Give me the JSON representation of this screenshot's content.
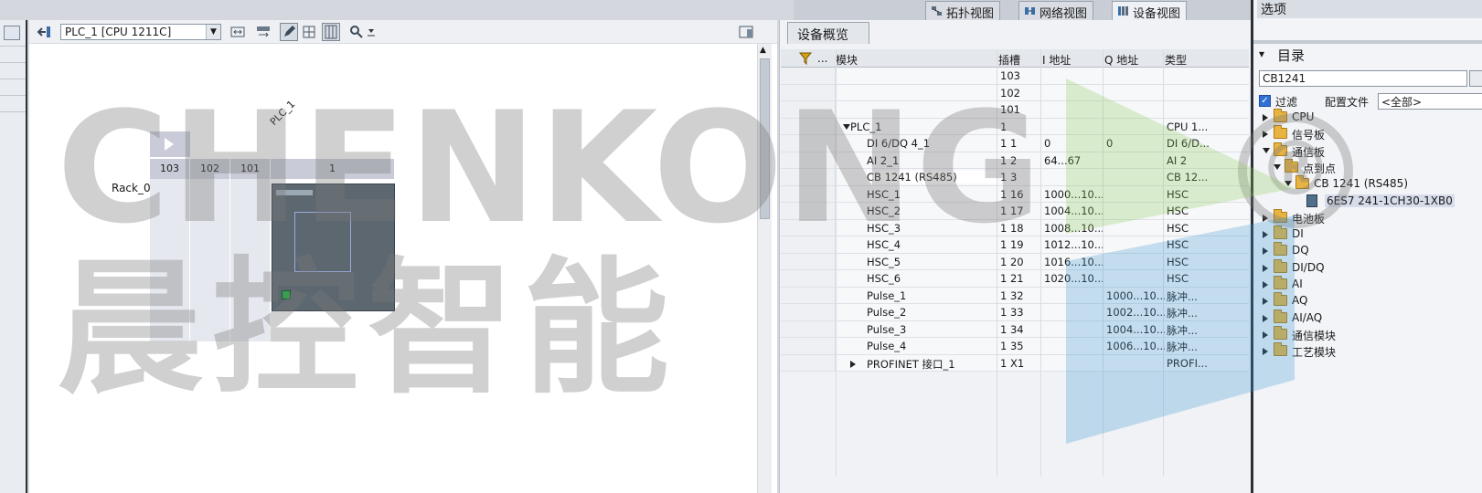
{
  "view_tabs": [
    {
      "label": "拓扑视图",
      "active": false
    },
    {
      "label": "网络视图",
      "active": false
    },
    {
      "label": "设备视图",
      "active": true
    }
  ],
  "canvas": {
    "device_select": "PLC_1 [CPU 1211C]",
    "rack_label": "Rack_0",
    "plc_label": "PLC_1",
    "slots": [
      "103",
      "102",
      "101",
      "1"
    ]
  },
  "overview": {
    "tab_label": "设备概览",
    "columns": {
      "dots": "...",
      "module": "模块",
      "slot": "插槽",
      "i_addr": "I 地址",
      "q_addr": "Q 地址",
      "type": "类型"
    },
    "rows": [
      {
        "module": "",
        "slot": "103",
        "i": "",
        "q": "",
        "type": "",
        "indent": 0,
        "exp": ""
      },
      {
        "module": "",
        "slot": "102",
        "i": "",
        "q": "",
        "type": "",
        "indent": 0,
        "exp": ""
      },
      {
        "module": "",
        "slot": "101",
        "i": "",
        "q": "",
        "type": "",
        "indent": 0,
        "exp": ""
      },
      {
        "module": "PLC_1",
        "slot": "1",
        "i": "",
        "q": "",
        "type": "CPU 1...",
        "indent": 1,
        "exp": "down"
      },
      {
        "module": "DI 6/DQ 4_1",
        "slot": "1 1",
        "i": "0",
        "q": "0",
        "type": "DI 6/D...",
        "indent": 2,
        "exp": ""
      },
      {
        "module": "AI 2_1",
        "slot": "1 2",
        "i": "64...67",
        "q": "",
        "type": "AI 2",
        "indent": 2,
        "exp": ""
      },
      {
        "module": "CB 1241 (RS485)",
        "slot": "1 3",
        "i": "",
        "q": "",
        "type": "CB 12...",
        "indent": 2,
        "exp": "",
        "selected": true
      },
      {
        "module": "HSC_1",
        "slot": "1 16",
        "i": "1000...10...",
        "q": "",
        "type": "HSC",
        "indent": 2,
        "exp": ""
      },
      {
        "module": "HSC_2",
        "slot": "1 17",
        "i": "1004...10...",
        "q": "",
        "type": "HSC",
        "indent": 2,
        "exp": ""
      },
      {
        "module": "HSC_3",
        "slot": "1 18",
        "i": "1008...10...",
        "q": "",
        "type": "HSC",
        "indent": 2,
        "exp": ""
      },
      {
        "module": "HSC_4",
        "slot": "1 19",
        "i": "1012...10...",
        "q": "",
        "type": "HSC",
        "indent": 2,
        "exp": ""
      },
      {
        "module": "HSC_5",
        "slot": "1 20",
        "i": "1016...10...",
        "q": "",
        "type": "HSC",
        "indent": 2,
        "exp": ""
      },
      {
        "module": "HSC_6",
        "slot": "1 21",
        "i": "1020...10...",
        "q": "",
        "type": "HSC",
        "indent": 2,
        "exp": ""
      },
      {
        "module": "Pulse_1",
        "slot": "1 32",
        "i": "",
        "q": "1000...10...",
        "type": "脉冲...",
        "indent": 2,
        "exp": ""
      },
      {
        "module": "Pulse_2",
        "slot": "1 33",
        "i": "",
        "q": "1002...10...",
        "type": "脉冲...",
        "indent": 2,
        "exp": ""
      },
      {
        "module": "Pulse_3",
        "slot": "1 34",
        "i": "",
        "q": "1004...10...",
        "type": "脉冲...",
        "indent": 2,
        "exp": ""
      },
      {
        "module": "Pulse_4",
        "slot": "1 35",
        "i": "",
        "q": "1006...10...",
        "type": "脉冲...",
        "indent": 2,
        "exp": ""
      },
      {
        "module": "PROFINET 接口_1",
        "slot": "1 X1",
        "i": "",
        "q": "",
        "type": "PROFI...",
        "indent": 2,
        "exp": "right"
      }
    ]
  },
  "options": {
    "title": "选项",
    "catalog_header": "目录",
    "search_value": "CB1241",
    "filter_label": "过滤",
    "profile_label": "配置文件",
    "profile_value": "<全部>",
    "tree": [
      {
        "label": "CPU",
        "level": 0,
        "exp": "right",
        "kind": "folder"
      },
      {
        "label": "信号板",
        "level": 0,
        "exp": "right",
        "kind": "folder"
      },
      {
        "label": "通信板",
        "level": 0,
        "exp": "down",
        "kind": "folder"
      },
      {
        "label": "点到点",
        "level": 1,
        "exp": "down",
        "kind": "folder"
      },
      {
        "label": "CB 1241 (RS485)",
        "level": 2,
        "exp": "down",
        "kind": "folder"
      },
      {
        "label": "6ES7 241-1CH30-1XB0",
        "level": 3,
        "exp": "",
        "kind": "module",
        "selected": true
      },
      {
        "label": "电池板",
        "level": 0,
        "exp": "right",
        "kind": "folder"
      },
      {
        "label": "DI",
        "level": 0,
        "exp": "right",
        "kind": "folder"
      },
      {
        "label": "DQ",
        "level": 0,
        "exp": "right",
        "kind": "folder"
      },
      {
        "label": "DI/DQ",
        "level": 0,
        "exp": "right",
        "kind": "folder"
      },
      {
        "label": "AI",
        "level": 0,
        "exp": "right",
        "kind": "folder"
      },
      {
        "label": "AQ",
        "level": 0,
        "exp": "right",
        "kind": "folder"
      },
      {
        "label": "AI/AQ",
        "level": 0,
        "exp": "right",
        "kind": "folder"
      },
      {
        "label": "通信模块",
        "level": 0,
        "exp": "right",
        "kind": "folder"
      },
      {
        "label": "工艺模块",
        "level": 0,
        "exp": "right",
        "kind": "folder"
      }
    ]
  },
  "watermark": {
    "latin": "CHENKONG",
    "chinese": "晨控智能",
    "reg": "®"
  }
}
